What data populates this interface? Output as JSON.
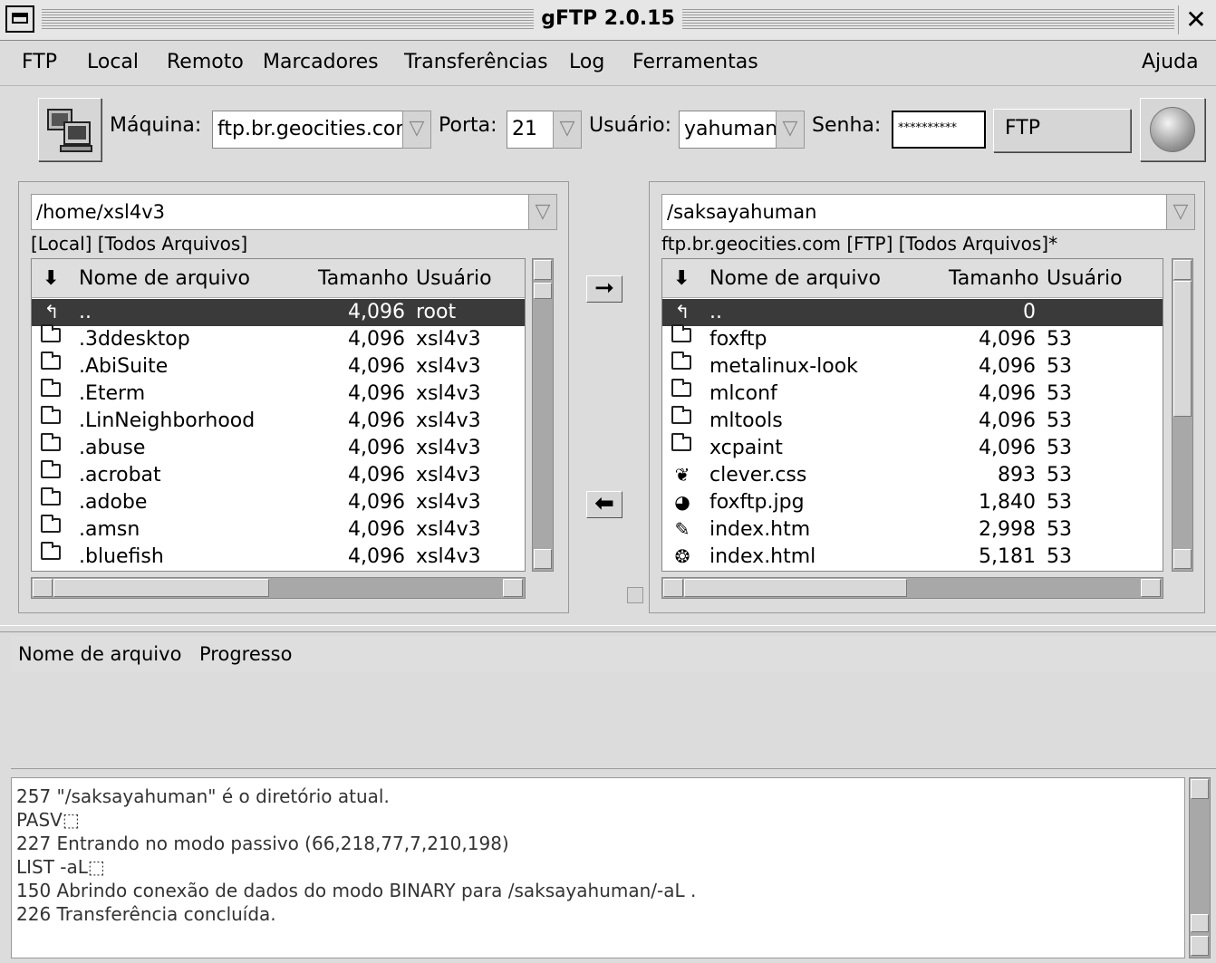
{
  "window": {
    "title": "gFTP 2.0.15"
  },
  "menubar": {
    "items": [
      "FTP",
      "Local",
      "Remoto",
      "Marcadores",
      "Transferências",
      "Log",
      "Ferramentas"
    ],
    "help": "Ajuda"
  },
  "toolbar": {
    "host_label": "Máquina:",
    "host_value": "ftp.br.geocities.com",
    "port_label": "Porta:",
    "port_value": "21",
    "user_label": "Usuário:",
    "user_value": "yahuman",
    "password_label": "Senha:",
    "password_value": "**********",
    "protocol": "FTP"
  },
  "local": {
    "path": "/home/xsl4v3",
    "subtitle": "[Local] [Todos Arquivos]",
    "columns": [
      "Nome de arquivo",
      "Tamanho",
      "Usuário"
    ],
    "rows": [
      {
        "icon": "parent-dir-icon",
        "name": "..",
        "size": "4,096",
        "user": "root",
        "selected": true
      },
      {
        "icon": "folder-icon",
        "name": ".3ddesktop",
        "size": "4,096",
        "user": "xsl4v3"
      },
      {
        "icon": "folder-icon",
        "name": ".AbiSuite",
        "size": "4,096",
        "user": "xsl4v3"
      },
      {
        "icon": "folder-icon",
        "name": ".Eterm",
        "size": "4,096",
        "user": "xsl4v3"
      },
      {
        "icon": "folder-icon",
        "name": ".LinNeighborhood",
        "size": "4,096",
        "user": "xsl4v3"
      },
      {
        "icon": "folder-icon",
        "name": ".abuse",
        "size": "4,096",
        "user": "xsl4v3"
      },
      {
        "icon": "folder-icon",
        "name": ".acrobat",
        "size": "4,096",
        "user": "xsl4v3"
      },
      {
        "icon": "folder-icon",
        "name": ".adobe",
        "size": "4,096",
        "user": "xsl4v3"
      },
      {
        "icon": "folder-icon",
        "name": ".amsn",
        "size": "4,096",
        "user": "xsl4v3"
      },
      {
        "icon": "folder-icon",
        "name": ".bluefish",
        "size": "4,096",
        "user": "xsl4v3"
      }
    ]
  },
  "remote": {
    "path": "/saksayahuman",
    "subtitle": "ftp.br.geocities.com [FTP] [Todos Arquivos]*",
    "columns": [
      "Nome de arquivo",
      "Tamanho",
      "Usuário"
    ],
    "rows": [
      {
        "icon": "parent-dir-icon",
        "name": "..",
        "size": "0",
        "user": "",
        "selected": true
      },
      {
        "icon": "folder-icon",
        "name": "foxftp",
        "size": "4,096",
        "user": "53"
      },
      {
        "icon": "folder-icon",
        "name": "metalinux-look",
        "size": "4,096",
        "user": "53"
      },
      {
        "icon": "folder-icon",
        "name": "mlconf",
        "size": "4,096",
        "user": "53"
      },
      {
        "icon": "folder-icon",
        "name": "mltools",
        "size": "4,096",
        "user": "53"
      },
      {
        "icon": "folder-icon",
        "name": "xcpaint",
        "size": "4,096",
        "user": "53"
      },
      {
        "icon": "css-file-icon",
        "name": "clever.css",
        "size": "893",
        "user": "53"
      },
      {
        "icon": "image-file-icon",
        "name": "foxftp.jpg",
        "size": "1,840",
        "user": "53"
      },
      {
        "icon": "html-file-icon",
        "name": "index.htm",
        "size": "2,998",
        "user": "53"
      },
      {
        "icon": "web-file-icon",
        "name": "index.html",
        "size": "5,181",
        "user": "53"
      }
    ]
  },
  "transfer": {
    "col_filename": "Nome de arquivo",
    "col_progress": "Progresso"
  },
  "log": [
    "257 \"/saksayahuman\" é o diretório atual.",
    "PASV⬚",
    "227 Entrando no modo passivo (66,218,77,7,210,198)",
    "LIST -aL⬚",
    "150  Abrindo conexão de dados do modo BINARY para /saksayahuman/-aL .",
    "226  Transferência concluída."
  ]
}
